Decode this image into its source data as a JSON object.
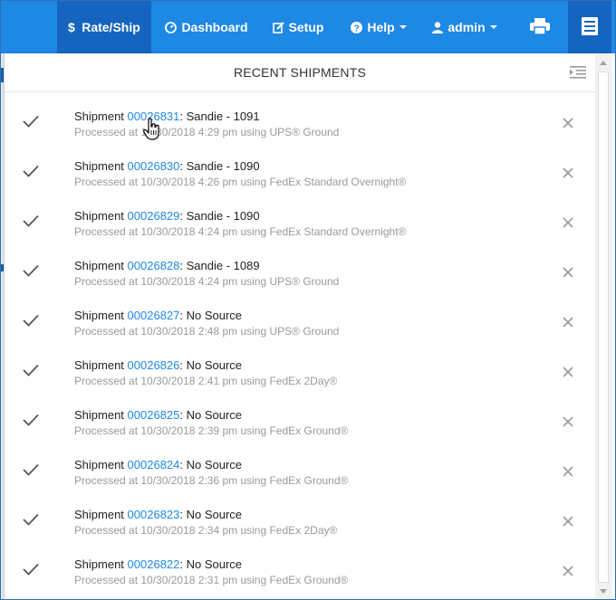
{
  "navbar": {
    "rate_ship": "Rate/Ship",
    "dashboard": "Dashboard",
    "setup": "Setup",
    "help": "Help",
    "admin": "admin",
    "rate_ship_icon": "dollar-icon",
    "dashboard_icon": "speedometer-icon",
    "setup_icon": "edit-icon",
    "help_icon": "question-circle-icon",
    "admin_icon": "user-icon",
    "print_icon": "printer-icon",
    "panel_icon": "list-panel-icon"
  },
  "panel": {
    "title": "RECENT SHIPMENTS",
    "collapse_icon": "indent-icon"
  },
  "shipments": [
    {
      "label": "Shipment",
      "id": "00026831",
      "source": ": Sandie - 1091",
      "status": "Processed at 10/30/2018 4:29 pm using UPS® Ground"
    },
    {
      "label": "Shipment",
      "id": "00026830",
      "source": ": Sandie - 1090",
      "status": "Processed at 10/30/2018 4:26 pm using FedEx Standard Overnight®"
    },
    {
      "label": "Shipment",
      "id": "00026829",
      "source": ": Sandie - 1090",
      "status": "Processed at 10/30/2018 4:24 pm using FedEx Standard Overnight®"
    },
    {
      "label": "Shipment",
      "id": "00026828",
      "source": ": Sandie - 1089",
      "status": "Processed at 10/30/2018 4:24 pm using UPS® Ground"
    },
    {
      "label": "Shipment",
      "id": "00026827",
      "source": ": No Source",
      "status": "Processed at 10/30/2018 2:48 pm using UPS® Ground"
    },
    {
      "label": "Shipment",
      "id": "00026826",
      "source": ": No Source",
      "status": "Processed at 10/30/2018 2:41 pm using FedEx 2Day®"
    },
    {
      "label": "Shipment",
      "id": "00026825",
      "source": ": No Source",
      "status": "Processed at 10/30/2018 2:39 pm using FedEx Ground®"
    },
    {
      "label": "Shipment",
      "id": "00026824",
      "source": ": No Source",
      "status": "Processed at 10/30/2018 2:36 pm using FedEx Ground®"
    },
    {
      "label": "Shipment",
      "id": "00026823",
      "source": ": No Source",
      "status": "Processed at 10/30/2018 2:34 pm using FedEx 2Day®"
    },
    {
      "label": "Shipment",
      "id": "00026822",
      "source": ": No Source",
      "status": "Processed at 10/30/2018 2:31 pm using FedEx Ground®"
    }
  ],
  "colors": {
    "navbar": "#1e88e5",
    "navbar_active": "#1565c0",
    "link": "#1e88e5",
    "muted_text": "#9a9a9a"
  }
}
